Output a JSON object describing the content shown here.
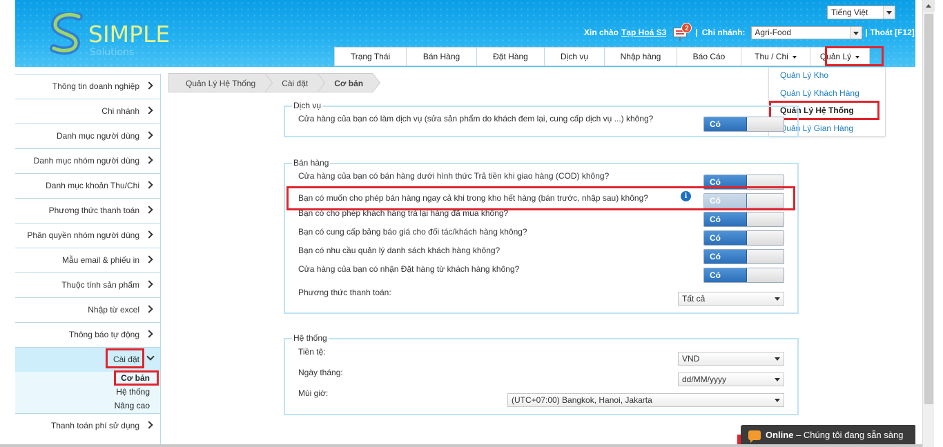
{
  "header": {
    "logo_text": "SIMPLE",
    "logo_sub": "Solutions",
    "language": "Tiếng Việt",
    "greeting": "Xin chào",
    "username": "Tạp Hoá S3",
    "notification_count": "2",
    "separator": "|",
    "branch_label": "Chi nhánh:",
    "branch_value": "Agri-Food",
    "logout": "| Thoát [F12]"
  },
  "nav": {
    "items": [
      {
        "label": "Trạng Thái"
      },
      {
        "label": "Bán Hàng"
      },
      {
        "label": "Đặt Hàng"
      },
      {
        "label": "Dịch vụ"
      },
      {
        "label": "Nhập hàng"
      },
      {
        "label": "Báo Cáo"
      },
      {
        "label": "Thu / Chi"
      },
      {
        "label": "Quản Lý"
      }
    ]
  },
  "dropdown": {
    "items": [
      {
        "label": "Quản Lý Kho"
      },
      {
        "label": "Quản Lý Khách Hàng"
      },
      {
        "label": "Quản Lý Hệ Thống"
      },
      {
        "label": "Quản Lý Gian Hàng"
      }
    ]
  },
  "sidebar": {
    "items": [
      {
        "label": "Thông tin doanh nghiệp"
      },
      {
        "label": "Chi nhánh"
      },
      {
        "label": "Danh mục người dùng"
      },
      {
        "label": "Danh mục nhóm người dùng"
      },
      {
        "label": "Danh mục khoản Thu/Chi"
      },
      {
        "label": "Phương thức thanh toán"
      },
      {
        "label": "Phân quyền nhóm người dùng"
      },
      {
        "label": "Mẫu email & phiếu in"
      },
      {
        "label": "Thuộc tính sản phẩm"
      },
      {
        "label": "Nhập từ excel"
      },
      {
        "label": "Thông báo tự động"
      },
      {
        "label": "Cài đặt"
      },
      {
        "label": "Thanh toán phí sử dụng"
      }
    ],
    "sub_items": [
      {
        "label": "Cơ bản"
      },
      {
        "label": "Hệ thống"
      },
      {
        "label": "Nâng cao"
      }
    ]
  },
  "breadcrumb": [
    "Quản Lý Hệ Thống",
    "Cài đặt",
    "Cơ bản"
  ],
  "service": {
    "legend": "Dịch vụ",
    "question": "Cửa hàng của bạn có làm dịch vụ (sửa sản phẩm do khách đem lại, cung cấp dịch vụ ...) không?",
    "toggle": "Có"
  },
  "sales": {
    "legend": "Bán hàng",
    "questions": [
      {
        "text": "Cửa hàng của bạn có bán hàng dưới hình thức Trả tiền khi giao hàng (COD) không?",
        "toggle": "Có"
      },
      {
        "text": "Bạn có muốn cho phép bán hàng ngay cả khi trong kho hết hàng (bán trước, nhập sau) không?",
        "toggle": "Có"
      },
      {
        "text": "Bạn có cho phép khách hàng trả lại hàng đã mua không?",
        "toggle": "Có"
      },
      {
        "text": "Bạn có cung cấp bảng báo giá cho đối tác/khách hàng không?",
        "toggle": "Có"
      },
      {
        "text": "Bạn có nhu cầu quản lý danh sách khách hàng không?",
        "toggle": "Có"
      },
      {
        "text": "Cửa hàng của bạn có nhận Đặt hàng từ khách hàng không?",
        "toggle": "Có"
      }
    ],
    "payment_label": "Phương thức thanh toán:",
    "payment_value": "Tất cả",
    "info_icon": "i"
  },
  "system": {
    "legend": "Hệ thống",
    "currency_label": "Tiền tệ:",
    "currency_value": "VND",
    "date_label": "Ngày tháng:",
    "date_value": "dd/MM/yyyy",
    "timezone_label": "Múi giờ:",
    "timezone_value": "(UTC+07:00) Bangkok, Hanoi, Jakarta"
  },
  "chat": {
    "status": "Online",
    "message": " – Chúng tôi đang sẵn sàng"
  },
  "colors": {
    "header_blue": "#22b0f0",
    "highlight_red": "#e0242c",
    "toggle_blue": "#2c6fb9",
    "link_blue": "#1a7dc4"
  }
}
